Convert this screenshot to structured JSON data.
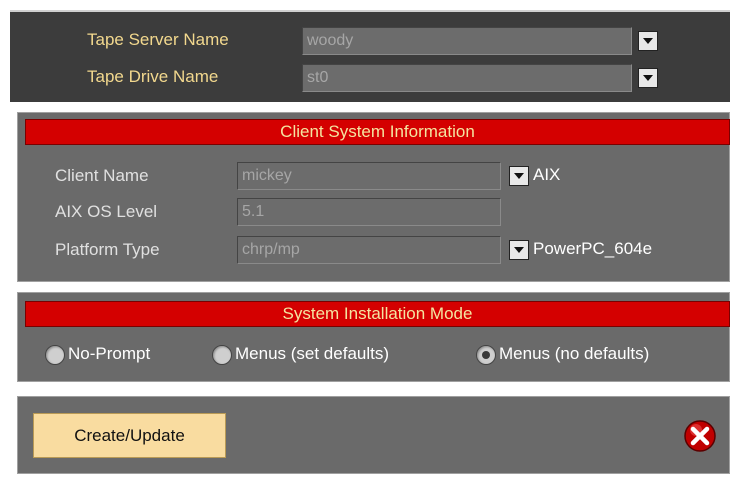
{
  "tape": {
    "server_label": "Tape Server Name",
    "server_value": "woody",
    "drive_label": "Tape Drive Name",
    "drive_value": "st0"
  },
  "client": {
    "title": "Client System Information",
    "name_label": "Client Name",
    "name_value": "mickey",
    "os_label": "AIX",
    "level_label": "AIX OS Level",
    "level_value": "5.1",
    "platform_label": "Platform Type",
    "platform_value": "chrp/mp",
    "processor": "PowerPC_604e"
  },
  "install": {
    "title": "System Installation Mode",
    "options": [
      "No-Prompt",
      "Menus (set defaults)",
      "Menus (no defaults)"
    ],
    "selected": "Menus (no defaults)"
  },
  "actions": {
    "create_label": "Create/Update"
  },
  "colors": {
    "title_bar": "#d40000",
    "panel": "#6a6a6a",
    "button": "#f9dca0"
  }
}
